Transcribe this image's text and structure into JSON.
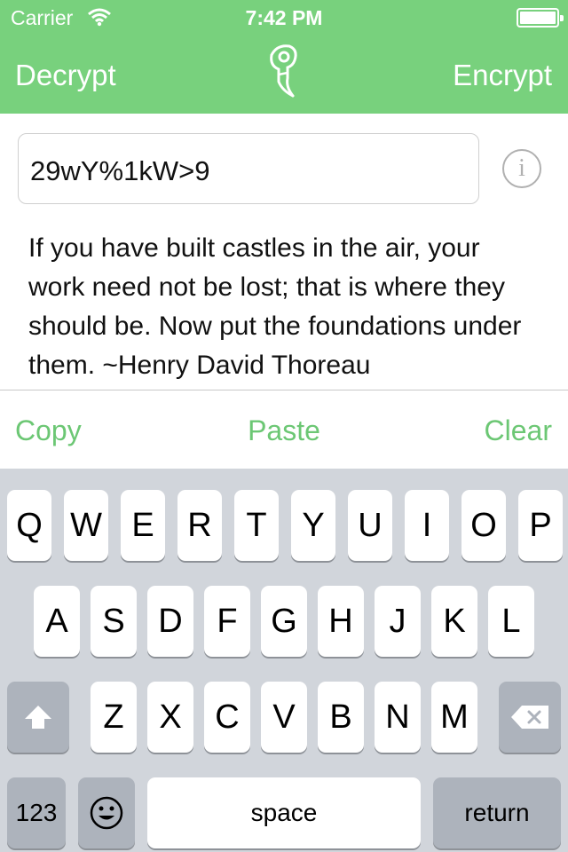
{
  "status": {
    "carrier": "Carrier",
    "time": "7:42 PM"
  },
  "nav": {
    "left": "Decrypt",
    "right": "Encrypt",
    "logo_icon": "lock-seal-icon"
  },
  "key_field": {
    "value": "29wY%1kW>9"
  },
  "info": {
    "glyph": "i"
  },
  "message": "If you have built castles in the air, your work need not be lost; that is where they should be. Now put the foundations under them. ~Henry David Thoreau",
  "actions": {
    "copy": "Copy",
    "paste": "Paste",
    "clear": "Clear"
  },
  "keyboard": {
    "row1": [
      "Q",
      "W",
      "E",
      "R",
      "T",
      "Y",
      "U",
      "I",
      "O",
      "P"
    ],
    "row2": [
      "A",
      "S",
      "D",
      "F",
      "G",
      "H",
      "J",
      "K",
      "L"
    ],
    "row3": [
      "Z",
      "X",
      "C",
      "V",
      "B",
      "N",
      "M"
    ],
    "numbers": "123",
    "space": "space",
    "return": "return"
  },
  "colors": {
    "accent": "#78d17d",
    "action_text": "#6cc774",
    "keyboard_bg": "#d1d5db"
  }
}
